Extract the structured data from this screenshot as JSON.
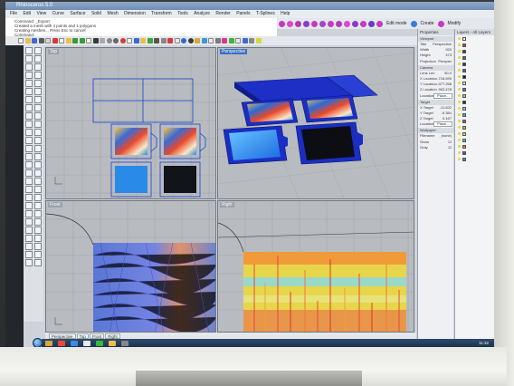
{
  "window": {
    "title": "Rhinoceros 5.0"
  },
  "menu": {
    "items": [
      "File",
      "Edit",
      "View",
      "Curve",
      "Surface",
      "Solid",
      "Mesh",
      "Dimension",
      "Transform",
      "Tools",
      "Analyze",
      "Render",
      "Panels",
      "T-Splines",
      "Help"
    ]
  },
  "command": {
    "lines": [
      "Command: _Export",
      "Created a mesh with 4 points and 1 polygons",
      "Creating meshes... Press Esc to cancel",
      "Command:"
    ]
  },
  "toolbar": {
    "named": [
      "Edit mode",
      "Create",
      "Modify"
    ]
  },
  "viewports": {
    "top": "Top",
    "perspective": "Perspective",
    "front": "Front",
    "right": "Right"
  },
  "properties": {
    "header": "Properties",
    "viewport_section": "Viewport",
    "rows": [
      {
        "label": "Title",
        "value": "Perspective"
      },
      {
        "label": "Width",
        "value": "920"
      },
      {
        "label": "Height",
        "value": "473"
      },
      {
        "label": "Projection",
        "value": "Perspec"
      }
    ],
    "camera_section": "Camera",
    "camera_rows": [
      {
        "label": "Lens Len",
        "value": "50.0"
      },
      {
        "label": "X Location",
        "value": "-718.690"
      },
      {
        "label": "Y Location",
        "value": "-977.268"
      },
      {
        "label": "Z Location",
        "value": "963.478"
      },
      {
        "label": "Location",
        "value": "Place..."
      }
    ],
    "target_section": "Target",
    "target_rows": [
      {
        "label": "X Target",
        "value": "-11.622"
      },
      {
        "label": "Y Target",
        "value": "-9.384"
      },
      {
        "label": "Z Target",
        "value": "0.167"
      },
      {
        "label": "Location",
        "value": "Place..."
      }
    ],
    "wallpaper_section": "Wallpaper",
    "wallpaper_rows": [
      {
        "label": "Filename",
        "value": "(none)"
      },
      {
        "label": "Show",
        "value": "☑"
      },
      {
        "label": "Gray",
        "value": "☑"
      }
    ]
  },
  "layers": {
    "header": "Layers - All Layers",
    "colors": [
      "#e9e9e9",
      "#d43a2a",
      "#7a2a1a",
      "#2a8a2a",
      "#2a2aa8",
      "#9a3ab8",
      "#1a1a1a",
      "#e0e0e0",
      "#3a7ad8",
      "#d8b83a",
      "#2a2a2a",
      "#b8b8b8",
      "#2abad8",
      "#d83a8a",
      "#8ad83a",
      "#d8d83a",
      "#3ad88a",
      "#d87a3a",
      "#7a3ad8",
      "#3a8ad8"
    ]
  },
  "status": {
    "tabs": [
      "Perspective",
      "Top",
      "Front",
      "Right"
    ],
    "snaps": [
      "End",
      "Near",
      "Point",
      "Mid",
      "Cen",
      "Int",
      "Perp",
      "Tan",
      "Quad",
      "Knot",
      "Vertex",
      "Project",
      "Disable"
    ],
    "modes": [
      "Grid Snap",
      "Ortho",
      "Planar",
      "Osnap",
      "SmartTrack",
      "Gumball",
      "Record History"
    ]
  },
  "taskbar": {
    "time": "11:32"
  },
  "colors": {
    "selection_blue": "#1b3fc9",
    "viewport_bg": "#b8bcc1",
    "active_label": "#3b6fc4"
  }
}
